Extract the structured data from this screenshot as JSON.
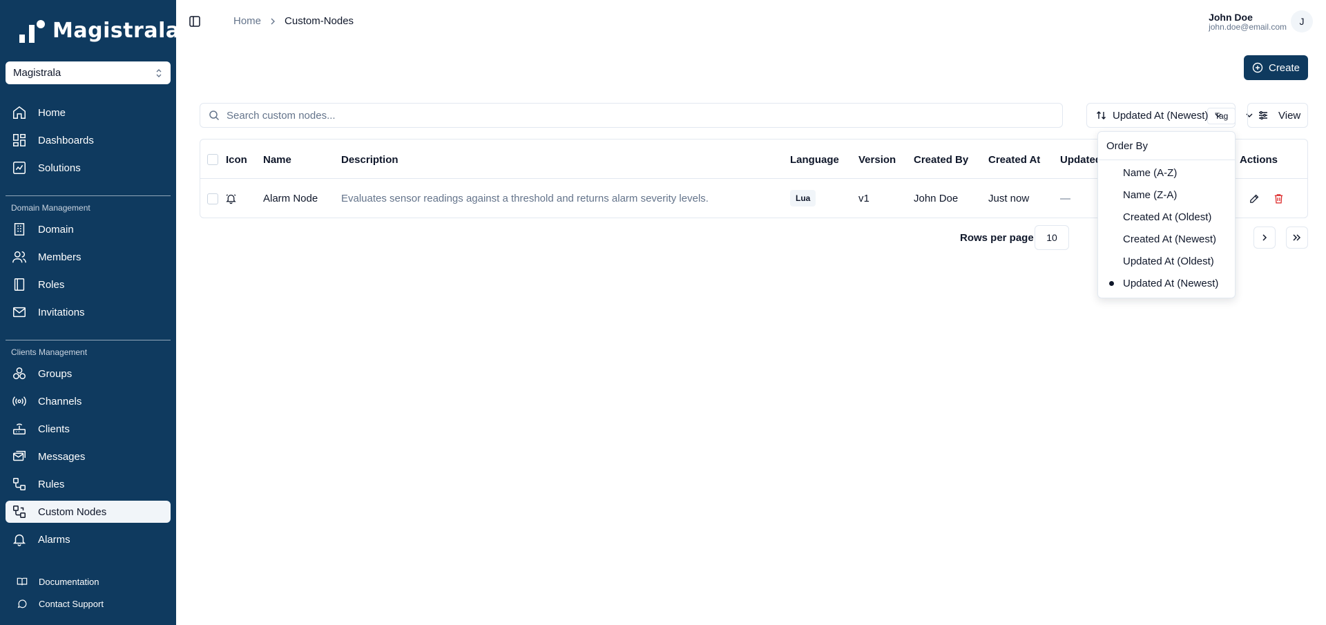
{
  "brand": {
    "name": "Magistrala"
  },
  "domain_select": {
    "value": "Magistrala"
  },
  "sidebar": {
    "primary": [
      {
        "label": "Home",
        "icon": "home-icon"
      },
      {
        "label": "Dashboards",
        "icon": "dashboard-icon"
      },
      {
        "label": "Solutions",
        "icon": "chart-icon"
      }
    ],
    "domain_section": "Domain Management",
    "domain_items": [
      {
        "label": "Domain",
        "icon": "building-icon"
      },
      {
        "label": "Members",
        "icon": "users-icon"
      },
      {
        "label": "Roles",
        "icon": "book-icon"
      },
      {
        "label": "Invitations",
        "icon": "mail-icon"
      }
    ],
    "clients_section": "Clients Management",
    "clients_items": [
      {
        "label": "Groups",
        "icon": "groups-icon"
      },
      {
        "label": "Channels",
        "icon": "radio-icon"
      },
      {
        "label": "Clients",
        "icon": "router-icon"
      },
      {
        "label": "Messages",
        "icon": "messages-icon"
      },
      {
        "label": "Rules",
        "icon": "workflow-icon"
      },
      {
        "label": "Custom Nodes",
        "icon": "custom-nodes-icon",
        "active": true
      },
      {
        "label": "Alarms",
        "icon": "bell-icon"
      }
    ],
    "footer": [
      {
        "label": "Documentation",
        "icon": "book-open-icon"
      },
      {
        "label": "Contact Support",
        "icon": "chat-icon"
      }
    ]
  },
  "breadcrumb": {
    "home": "Home",
    "current": "Custom-Nodes"
  },
  "user": {
    "name": "John Doe",
    "email": "john.doe@email.com",
    "initial": "J"
  },
  "actions": {
    "create": "Create",
    "view": "View"
  },
  "search": {
    "placeholder": "Search custom nodes...",
    "tag_label": "Tag"
  },
  "sort": {
    "current": "Updated At (Newest)"
  },
  "table": {
    "headers": [
      "Icon",
      "Name",
      "Description",
      "Language",
      "Version",
      "Created By",
      "Created At",
      "Updated",
      "Actions"
    ],
    "rows": [
      {
        "icon": "bell-icon",
        "name": "Alarm Node",
        "description": "Evaluates sensor readings against a threshold and returns alarm severity levels.",
        "language": "Lua",
        "version": "v1",
        "created_by": "John Doe",
        "created_at": "Just now",
        "updated": "—"
      }
    ]
  },
  "pagination": {
    "rows_label": "Rows per page",
    "rows_value": "10"
  },
  "dropdown": {
    "label": "Order By",
    "options": [
      "Name (A-Z)",
      "Name (Z-A)",
      "Created At (Oldest)",
      "Created At (Newest)",
      "Updated At (Oldest)",
      "Updated At (Newest)"
    ],
    "selected": "Updated At (Newest)"
  },
  "colors": {
    "sidebar": "#0f3a5f",
    "accent": "#0f3a5f",
    "delete": "#dc2626"
  }
}
